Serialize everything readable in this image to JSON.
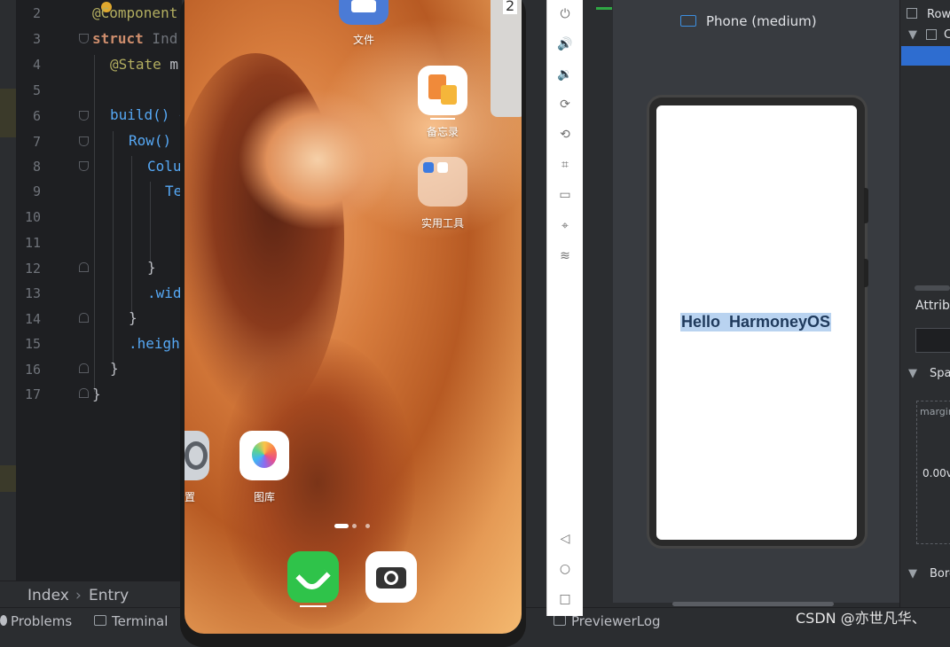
{
  "editor": {
    "line_numbers": [
      "2",
      "3",
      "4",
      "5",
      "6",
      "7",
      "8",
      "9",
      "10",
      "11",
      "12",
      "13",
      "14",
      "15",
      "16",
      "17"
    ],
    "lines": {
      "l2": "@Component",
      "l3a": "struct",
      "l3b": " Ind",
      "l4a": "@State",
      "l4b": " m",
      "l6": "build() {",
      "l7": "Row() {",
      "l8": "Colu",
      "l9": "Te",
      "l12": "}",
      "l13": ".wid",
      "l14": "}",
      "l15": ".heigh",
      "l16": "}",
      "l17": "}"
    }
  },
  "breadcrumb": {
    "file": "Index",
    "separator": "›",
    "symbol": "Entry"
  },
  "bottom_tabs": {
    "problems": "Problems",
    "terminal": "Terminal",
    "previewer_log": "PreviewerLog"
  },
  "home_screen": {
    "apps": {
      "files": "文件",
      "memo": "备忘录",
      "tools": "实用工具",
      "settings_partial": "置",
      "gallery": "图库"
    },
    "recent_badge": "2"
  },
  "emulator_toolbar": {
    "icons": [
      "power-icon",
      "volume-up-icon",
      "volume-down-icon",
      "rotate-icon",
      "rotate-back-icon",
      "crop-icon",
      "battery-icon",
      "location-icon",
      "wifi-icon",
      "back-icon",
      "home-icon",
      "recent-icon"
    ]
  },
  "previewer": {
    "device": "Phone (medium)",
    "hello_text": "Hello  HarmoneyOS"
  },
  "inspector": {
    "tree_row": "Row",
    "tree_col_partial": "C",
    "attributes": "Attribu",
    "spacing": "Spa",
    "margin": "margin",
    "margin_value": "0.00v",
    "border": "Bord"
  },
  "watermark": "CSDN @亦世凡华、"
}
